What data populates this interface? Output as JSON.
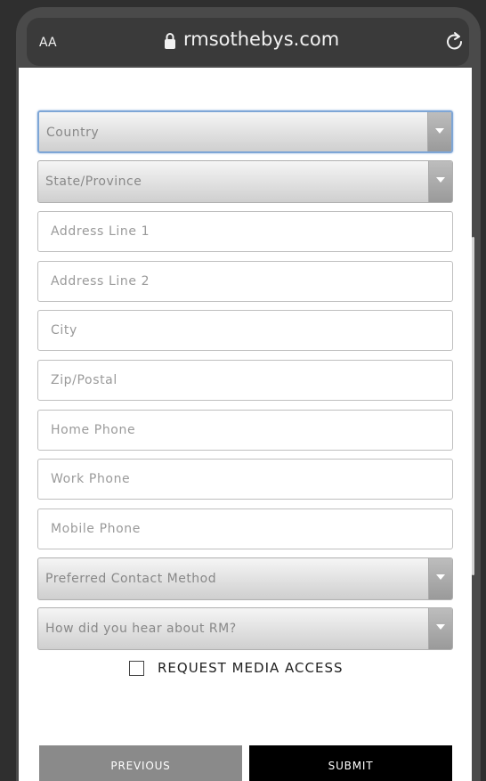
{
  "browser": {
    "text_size_label": "AA",
    "url": "rmsothebys.com",
    "icons": {
      "lock": "lock-icon",
      "reload": "reload-icon"
    }
  },
  "form": {
    "country": "Country",
    "state": "State/Province",
    "address1": "Address Line 1",
    "address2": "Address Line 2",
    "city": "City",
    "zip": "Zip/Postal",
    "home_phone": "Home Phone",
    "work_phone": "Work Phone",
    "mobile_phone": "Mobile Phone",
    "contact_method": "Preferred Contact Method",
    "heard_about": "How did you hear about RM?",
    "media_access": "REQUEST MEDIA ACCESS"
  },
  "buttons": {
    "previous": "PREVIOUS",
    "submit": "SUBMIT"
  },
  "colors": {
    "focus_border": "#7ea6d6",
    "submit_bg": "#000000",
    "previous_bg": "#8a8a8a"
  }
}
